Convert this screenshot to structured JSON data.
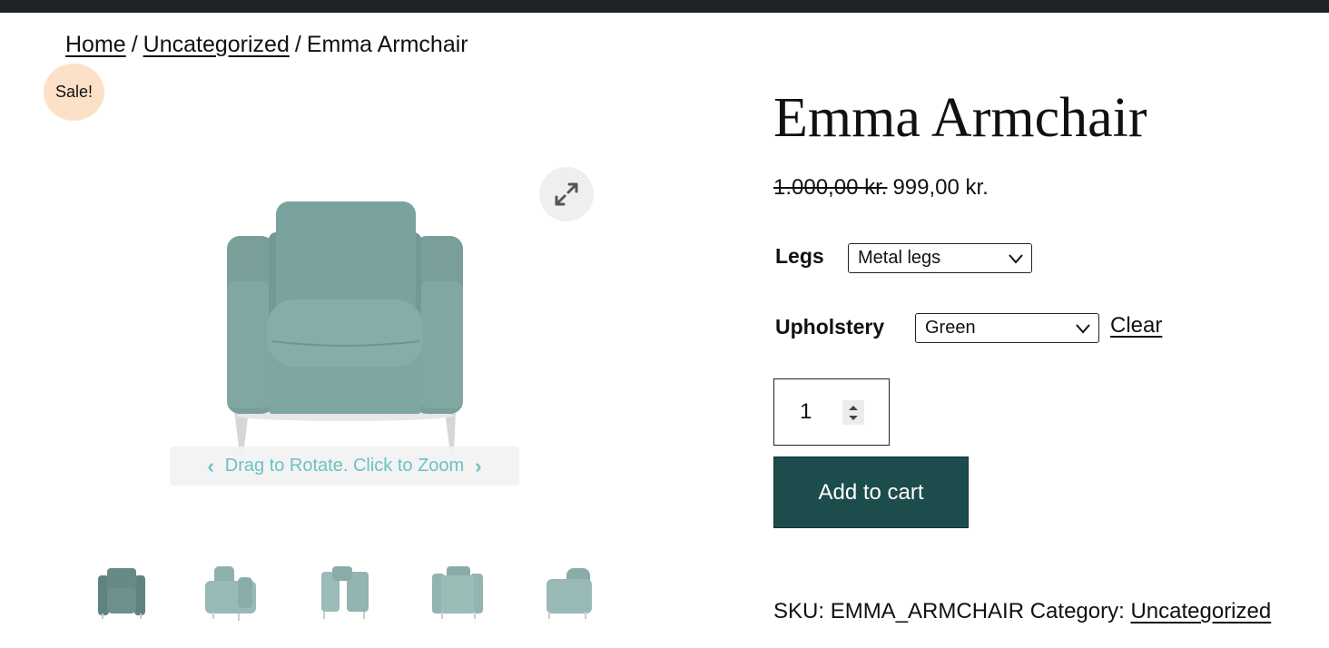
{
  "breadcrumb": {
    "home": "Home",
    "sep1": "/",
    "category": "Uncategorized",
    "sep2": "/",
    "current": "Emma Armchair"
  },
  "badge": {
    "sale": "Sale!"
  },
  "gallery": {
    "rotate_hint": "Drag to Rotate. Click to Zoom",
    "thumbnails_count_shown": 5,
    "chair_color": "#7ba39f",
    "hint_color": "#6cc2c2"
  },
  "product": {
    "title": "Emma Armchair",
    "price_old": "1.000,00 kr.",
    "price_new": "999,00 kr."
  },
  "variations": {
    "legs_label": "Legs",
    "legs_value": "Metal legs",
    "upholstery_label": "Upholstery",
    "upholstery_value": "Green",
    "clear_label": "Clear"
  },
  "cart": {
    "quantity": "1",
    "add_label": "Add to cart",
    "button_color": "#1d4c4c"
  },
  "meta": {
    "sku_label": "SKU:",
    "sku_value": "EMMA_ARMCHAIR",
    "category_label": "Category:",
    "category_value": "Uncategorized"
  },
  "colors": {
    "sale_badge": "#fde0c8",
    "topbar": "#1f2326"
  }
}
